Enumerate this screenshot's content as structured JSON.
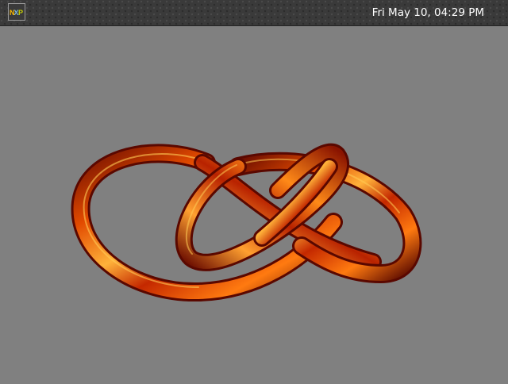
{
  "panel": {
    "logo_icon": "nxp-logo",
    "logo_text": "NXP",
    "clock": "Fri May 10, 04:29 PM"
  },
  "desktop": {
    "background_color": "#808080",
    "content": "3D rendered red-orange torus knot"
  },
  "colors": {
    "panel_bg": "#3a3a3a",
    "knot_dark": "#7a1000",
    "knot_mid": "#d63000",
    "knot_light": "#ffb020"
  }
}
